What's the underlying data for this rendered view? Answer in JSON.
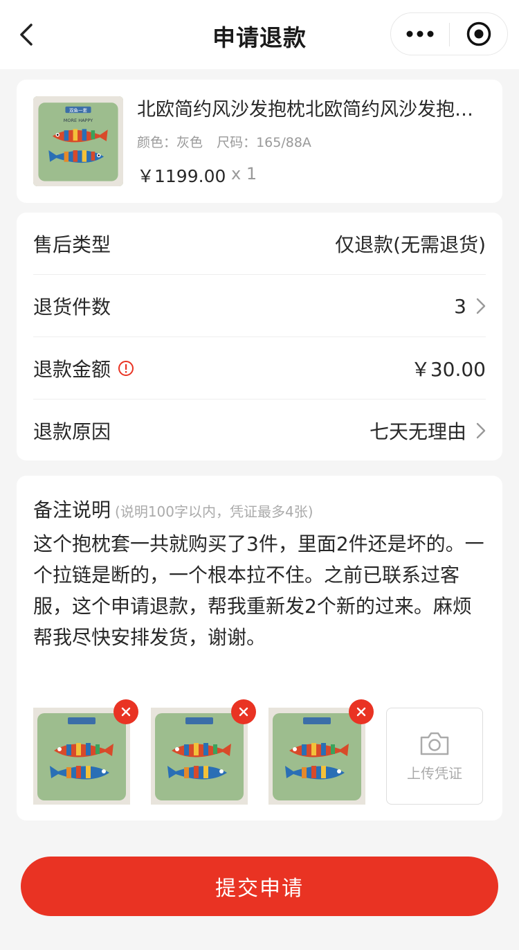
{
  "header": {
    "title": "申请退款"
  },
  "product": {
    "name": "北欧简约风沙发抱枕北欧简约风沙发抱枕套",
    "attr_color": "颜色：灰色",
    "attr_size": "尺码：165/88A",
    "price": "￥1199.00",
    "quantity": "x 1",
    "thumb_tag": "双鱼一套",
    "thumb_caption": "MORE HAPPY"
  },
  "form": {
    "after_sale_type": {
      "label": "售后类型",
      "value": "仅退款(无需退货)"
    },
    "return_count": {
      "label": "退货件数",
      "value": "3"
    },
    "refund_amount": {
      "label": "退款金额",
      "value": "￥30.00"
    },
    "refund_reason": {
      "label": "退款原因",
      "value": "七天无理由"
    }
  },
  "notes": {
    "title": "备注说明",
    "hint": "(说明100字以内，凭证最多4张)",
    "text": "这个抱枕套一共就购买了3件，里面2件还是坏的。一个拉链是断的，一个根本拉不住。之前已联系过客服，这个申请退款，帮我重新发2个新的过来。麻烦帮我尽快安排发货，谢谢。",
    "upload_label": "上传凭证"
  },
  "submit": {
    "label": "提交申请"
  },
  "colors": {
    "accent": "#e93323",
    "page_bg": "#f5f5f5",
    "text": "#282828",
    "muted": "#999999"
  }
}
